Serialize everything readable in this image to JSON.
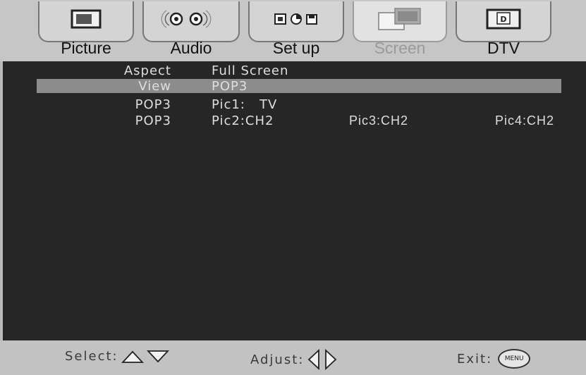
{
  "tabs": [
    {
      "label": "Picture",
      "icon": "tv-screen-icon",
      "active": false
    },
    {
      "label": "Audio",
      "icon": "speaker-icon",
      "active": false
    },
    {
      "label": "Set up",
      "icon": "setup-icons",
      "active": false
    },
    {
      "label": "Screen",
      "icon": "screen-layout-icon",
      "active": true
    },
    {
      "label": "DTV",
      "icon": "dtv-icon",
      "active": false
    }
  ],
  "dtv_icon_letter": "D",
  "rows": [
    {
      "label": "Aspect",
      "value": "Full Screen",
      "selected": false
    },
    {
      "label": "View",
      "value": "POP3",
      "selected": true
    },
    {
      "label": "POP3",
      "value": "Pic1:   TV",
      "selected": false
    },
    {
      "label": "POP3",
      "value": "Pic2:CH2",
      "value3": "Pic3:CH2",
      "value4": "Pic4:CH2",
      "selected": false
    }
  ],
  "footer": {
    "select_label": "Select:",
    "adjust_label": "Adjust:",
    "exit_label": "Exit:",
    "menu_button": "MENU"
  },
  "colors": {
    "panel_bg": "#262626",
    "highlight": "#8c8c8c",
    "text": "#dedede"
  }
}
